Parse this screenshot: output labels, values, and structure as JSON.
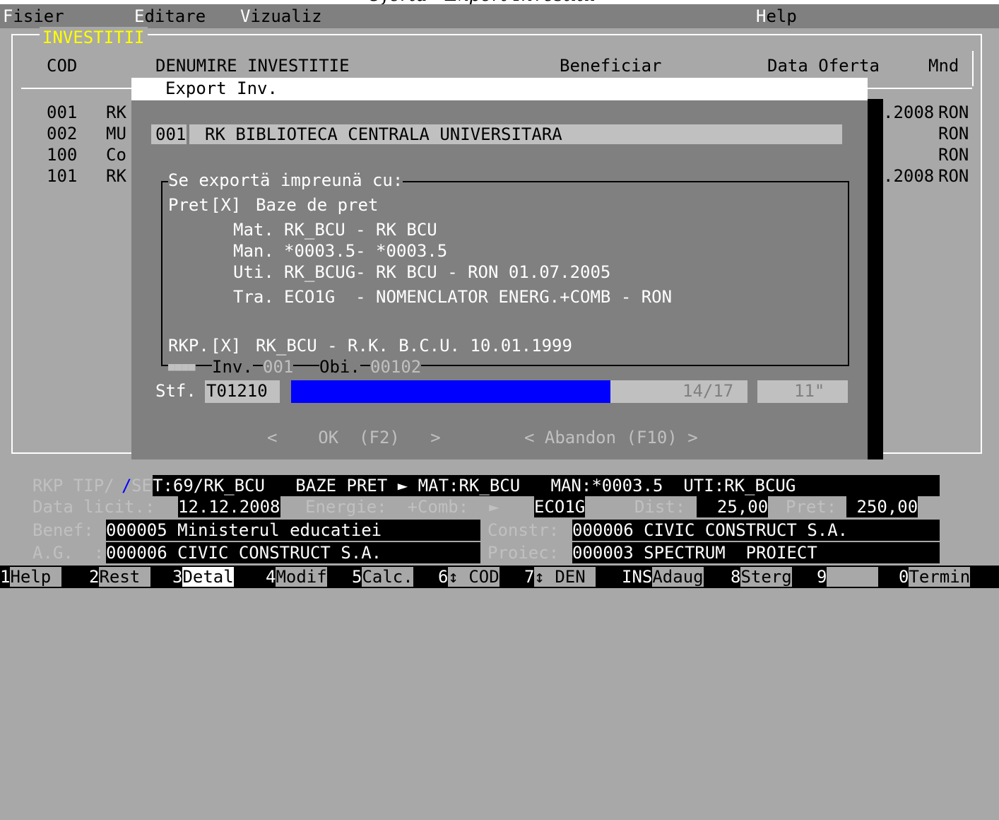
{
  "window_title": "Oferta - Export Investitii",
  "menu": [
    {
      "hotkey": "F",
      "rest": "isier"
    },
    {
      "hotkey": "E",
      "rest": "ditare"
    },
    {
      "hotkey": "V",
      "rest": "izualiz"
    },
    {
      "hotkey": "H",
      "rest": "elp"
    }
  ],
  "list": {
    "title": "INVESTITII",
    "headers": {
      "cod": "COD",
      "denumire": "DENUMIRE INVESTITIE",
      "beneficiar": "Beneficiar",
      "data_oferta": "Data Oferta",
      "mnd": "Mnd"
    },
    "rows": [
      {
        "cod": "001",
        "den": "RK",
        "date": ".2008",
        "mnd": "RON"
      },
      {
        "cod": "002",
        "den": "MU",
        "date": ".",
        "mnd": "RON"
      },
      {
        "cod": "100",
        "den": "Co",
        "date": ".",
        "mnd": "RON"
      },
      {
        "cod": "101",
        "den": "RK",
        "date": ".2008",
        "mnd": "RON"
      }
    ]
  },
  "dialog": {
    "title": "Export Inv.",
    "inv_code": "001",
    "inv_name": "RK BIBLIOTECA CENTRALA UNIVERSITARA",
    "group_title": "Se exportä impreunä cu:",
    "pret_label": "Pret",
    "pret_check": "[X]",
    "pret_text": "Baze de pret",
    "mat_label": "Mat.",
    "mat_value": "RK_BCU - RK BCU",
    "man_label": "Man.",
    "man_value": "*0003.5- *0003.5",
    "uti_label": "Uti.",
    "uti_value": "RK_BCUG- RK BCU - RON 01.07.2005",
    "tra_label": "Tra.",
    "tra_value": "ECO1G  - NOMENCLATOR ENERG.+COMB - RON",
    "rkp_label": "RKP.",
    "rkp_check": "[X]",
    "rkp_value": "RK_BCU - R.K. B.C.U. 10.01.1999",
    "progress_blocks": "■■■■",
    "inv_label": "Inv.",
    "inv_val": "001",
    "obi_label": "Obi.",
    "obi_val": "00102",
    "stf_label": "Stf.",
    "stf_value": "T01210",
    "progress_fraction": 0.7,
    "progress_count": "14/17",
    "seconds": "11\"",
    "ok_button": "<    OK  (F2)   >",
    "cancel_button": "< Abandon (F10) >"
  },
  "status": {
    "line1_label": "RKP TIP/",
    "line1_slash": "/",
    "line1_se": "SE",
    "line1_value": "T:69/RK_BCU   BAZE PRET ► MAT:RK_BCU   MAN:*0003.5  UTI:RK_BCUG",
    "data_licit_label": "Data licit.:",
    "data_licit_value": "12.12.2008",
    "energie_label": "Energie:  +Comb:  ►",
    "energie_value": "ECO1G",
    "dist_label": "Dist:",
    "dist_value": "  25,00",
    "pret_label": "Pret:",
    "pret_value": " 250,00",
    "benef_label": "Benef:",
    "benef_value": "000005 Ministerul educatiei",
    "constr_label": "Constr:",
    "constr_value": "000006 CIVIC CONSTRUCT S.A.",
    "ag_label": "A.G.  :",
    "ag_value": "000006 CIVIC CONSTRUCT S.A.",
    "proiec_label": "Proiec:",
    "proiec_value": "000003 SPECTRUM  PROIECT"
  },
  "fkeys": [
    {
      "num": "1",
      "label": "Help "
    },
    {
      "num": "2",
      "label": "Rest "
    },
    {
      "num": "3",
      "label": "Detal"
    },
    {
      "num": "4",
      "label": "Modif"
    },
    {
      "num": "5",
      "label": "Calc."
    },
    {
      "num": "6",
      "label": "↕ COD"
    },
    {
      "num": "7",
      "label": "↕ DEN "
    },
    {
      "num": "INS",
      "label": "Adaug"
    },
    {
      "num": "8",
      "label": "Sterg"
    },
    {
      "num": "9",
      "label": "     "
    },
    {
      "num": "0",
      "label": "Termin"
    }
  ]
}
